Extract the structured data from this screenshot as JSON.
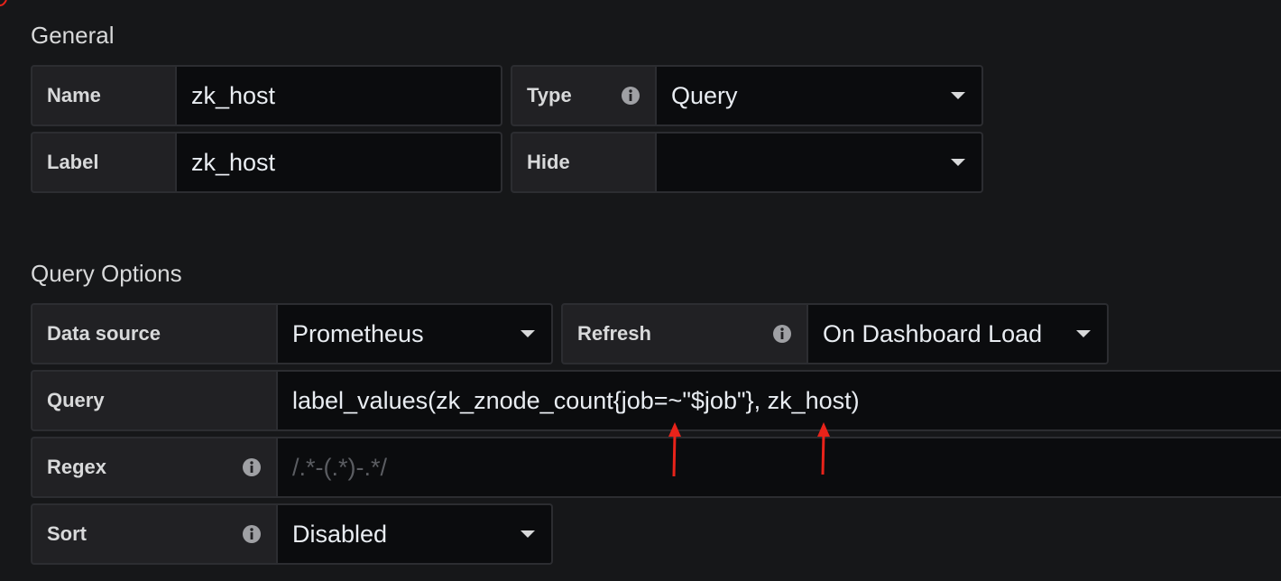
{
  "general": {
    "title": "General",
    "name_label": "Name",
    "name_value": "zk_host",
    "type_label": "Type",
    "type_value": "Query",
    "label_label": "Label",
    "label_value": "zk_host",
    "hide_label": "Hide",
    "hide_value": ""
  },
  "query_options": {
    "title": "Query Options",
    "datasource_label": "Data source",
    "datasource_value": "Prometheus",
    "refresh_label": "Refresh",
    "refresh_value": "On Dashboard Load",
    "query_label": "Query",
    "query_value": "label_values(zk_znode_count{job=~\"$job\"}, zk_host)",
    "regex_label": "Regex",
    "regex_placeholder": "/.*-(.*)-.*/",
    "sort_label": "Sort",
    "sort_value": "Disabled"
  },
  "colors": {
    "background": "#161719",
    "label_bg": "#212124",
    "input_bg": "#0b0c0e",
    "annotation_arrow": "#e8231a"
  },
  "icons": [
    "info-icon",
    "chevron-down-icon",
    "red-arrow-annotation"
  ]
}
